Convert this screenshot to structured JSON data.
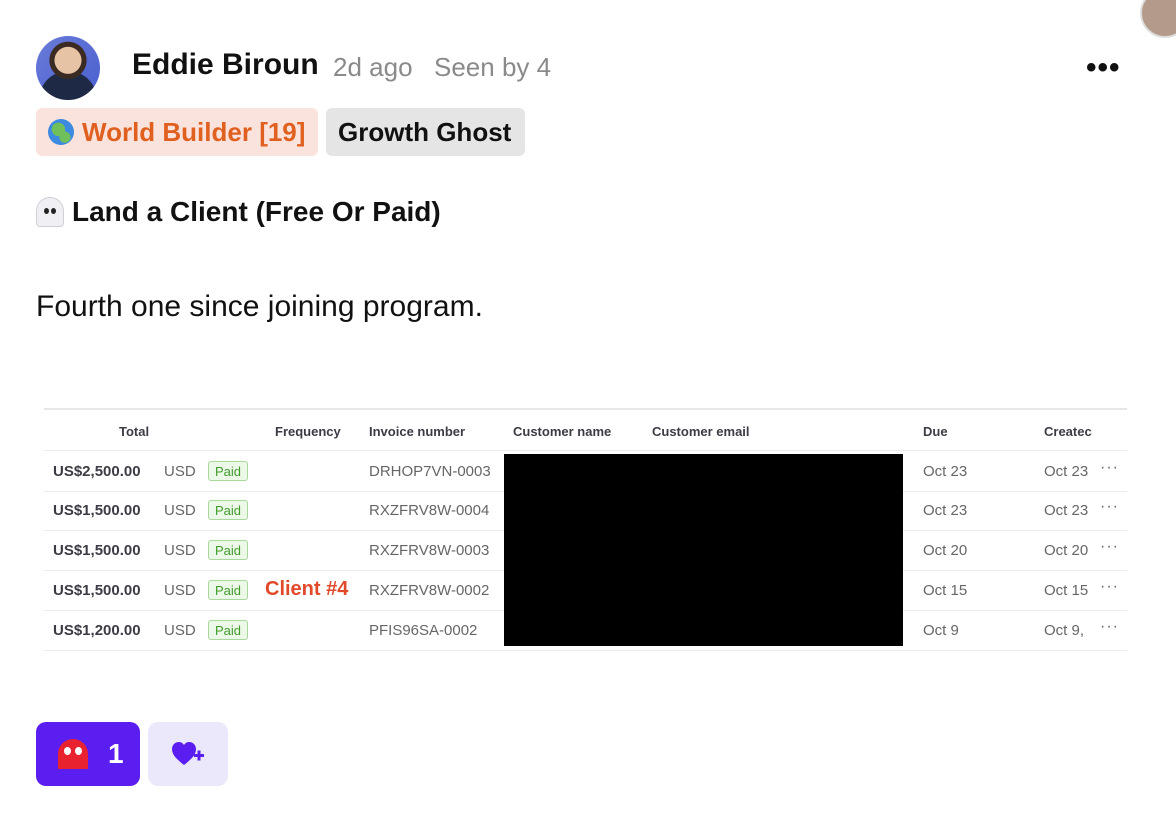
{
  "post": {
    "author": "Eddie Biroun",
    "time": "2d ago",
    "seen": "Seen by 4",
    "more_label": "•••",
    "badges": [
      {
        "label": "World Builder [19]",
        "icon": "globe-icon",
        "color": "#e0601f",
        "bg": "#fbe3dd"
      },
      {
        "label": "Growth Ghost",
        "color": "#111111",
        "bg": "#e5e5e5"
      }
    ],
    "title": "Land a Client (Free Or Paid)",
    "title_icon": "ghost-icon",
    "body": "Fourth one since joining program."
  },
  "invoice_table": {
    "headers": {
      "total": "Total",
      "frequency": "Frequency",
      "invoice_number": "Invoice number",
      "customer_name": "Customer name",
      "customer_email": "Customer email",
      "due": "Due",
      "created": "Createc"
    },
    "rows": [
      {
        "amount": "US$2,500.00",
        "currency": "USD",
        "status": "Paid",
        "invoice": "DRHOP7VN-0003",
        "due": "Oct 23",
        "created": "Oct 23",
        "more": "···"
      },
      {
        "amount": "US$1,500.00",
        "currency": "USD",
        "status": "Paid",
        "invoice": "RXZFRV8W-0004",
        "due": "Oct 23",
        "created": "Oct 23",
        "more": "···"
      },
      {
        "amount": "US$1,500.00",
        "currency": "USD",
        "status": "Paid",
        "invoice": "RXZFRV8W-0003",
        "due": "Oct 20",
        "created": "Oct 20",
        "more": "···"
      },
      {
        "amount": "US$1,500.00",
        "currency": "USD",
        "status": "Paid",
        "invoice": "RXZFRV8W-0002",
        "due": "Oct 15",
        "created": "Oct 15",
        "more": "···"
      },
      {
        "amount": "US$1,200.00",
        "currency": "USD",
        "status": "Paid",
        "invoice": "PFIS96SA-0002",
        "due": "Oct 9",
        "created": "Oct 9,",
        "more": "···"
      }
    ],
    "annotation": "Client #4"
  },
  "reactions": {
    "count": "1",
    "icon": "pacman-ghost-icon",
    "add_icon": "heart-plus-icon"
  },
  "colors": {
    "accent": "#5a1ef0",
    "annotation": "#e04a2b",
    "paid_green": "#3f9b2a"
  }
}
